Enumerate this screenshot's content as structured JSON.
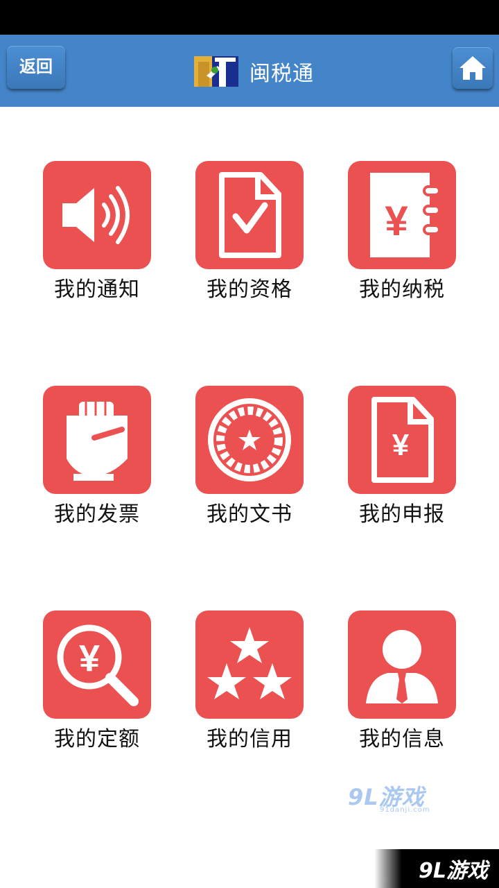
{
  "header": {
    "back_label": "返回",
    "title": "闽税通",
    "home_icon": "home-icon",
    "logo_icon": "app-logo-icon"
  },
  "colors": {
    "nav_background": "#4485c9",
    "tile_background": "#ec5151",
    "page_background": "#ffffff"
  },
  "menu": [
    {
      "label": "我的通知",
      "icon": "speaker-icon"
    },
    {
      "label": "我的资格",
      "icon": "document-check-icon"
    },
    {
      "label": "我的纳税",
      "icon": "yuan-notebook-icon"
    },
    {
      "label": "我的发票",
      "icon": "hand-invoice-icon"
    },
    {
      "label": "我的文书",
      "icon": "seal-icon"
    },
    {
      "label": "我的申报",
      "icon": "yuan-document-icon"
    },
    {
      "label": "我的定额",
      "icon": "yuan-search-icon"
    },
    {
      "label": "我的信用",
      "icon": "stars-icon"
    },
    {
      "label": "我的信息",
      "icon": "user-icon"
    }
  ],
  "watermark": {
    "mid_text": "9L游戏",
    "mid_sub": "91danji.com",
    "corner_text": "9L游戏"
  }
}
